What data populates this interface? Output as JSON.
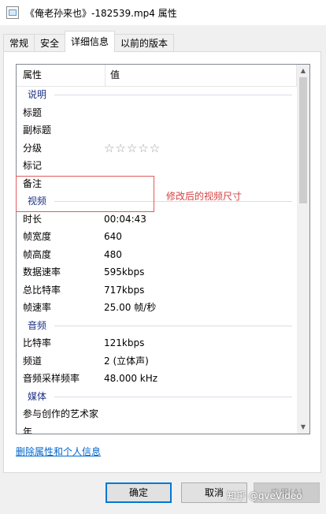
{
  "window": {
    "title": "《俺老孙来也》-182539.mp4 属性"
  },
  "tabs": [
    {
      "label": "常规",
      "active": false
    },
    {
      "label": "安全",
      "active": false
    },
    {
      "label": "详细信息",
      "active": true
    },
    {
      "label": "以前的版本",
      "active": false
    }
  ],
  "table": {
    "col_property": "属性",
    "col_value": "值"
  },
  "sections": {
    "description": "说明",
    "video": "视频",
    "audio": "音频",
    "media": "媒体"
  },
  "description_rows": [
    {
      "k": "标题",
      "v": ""
    },
    {
      "k": "副标题",
      "v": ""
    },
    {
      "k": "分级",
      "v": ""
    },
    {
      "k": "标记",
      "v": ""
    },
    {
      "k": "备注",
      "v": ""
    }
  ],
  "rating": {
    "stars": "☆☆☆☆☆",
    "value": 0,
    "max": 5
  },
  "video_rows": [
    {
      "k": "时长",
      "v": "00:04:43"
    },
    {
      "k": "帧宽度",
      "v": "640"
    },
    {
      "k": "帧高度",
      "v": "480"
    },
    {
      "k": "数据速率",
      "v": "595kbps"
    },
    {
      "k": "总比特率",
      "v": "717kbps"
    },
    {
      "k": "帧速率",
      "v": "25.00 帧/秒"
    }
  ],
  "audio_rows": [
    {
      "k": "比特率",
      "v": "121kbps"
    },
    {
      "k": "频道",
      "v": "2 (立体声)"
    },
    {
      "k": "音频采样频率",
      "v": "48.000 kHz"
    }
  ],
  "media_rows": [
    {
      "k": "参与创作的艺术家",
      "v": ""
    },
    {
      "k": "年",
      "v": ""
    }
  ],
  "annotation": "修改后的视频尺寸",
  "remove_link": "删除属性和个人信息",
  "buttons": {
    "ok": "确定",
    "cancel": "取消",
    "apply": "应用(A)"
  },
  "watermark": "知乎 @qveVideo",
  "colors": {
    "highlight": "#e15a5a",
    "section_text": "#1e3287",
    "link": "#0066cc",
    "accent": "#0078d7"
  }
}
